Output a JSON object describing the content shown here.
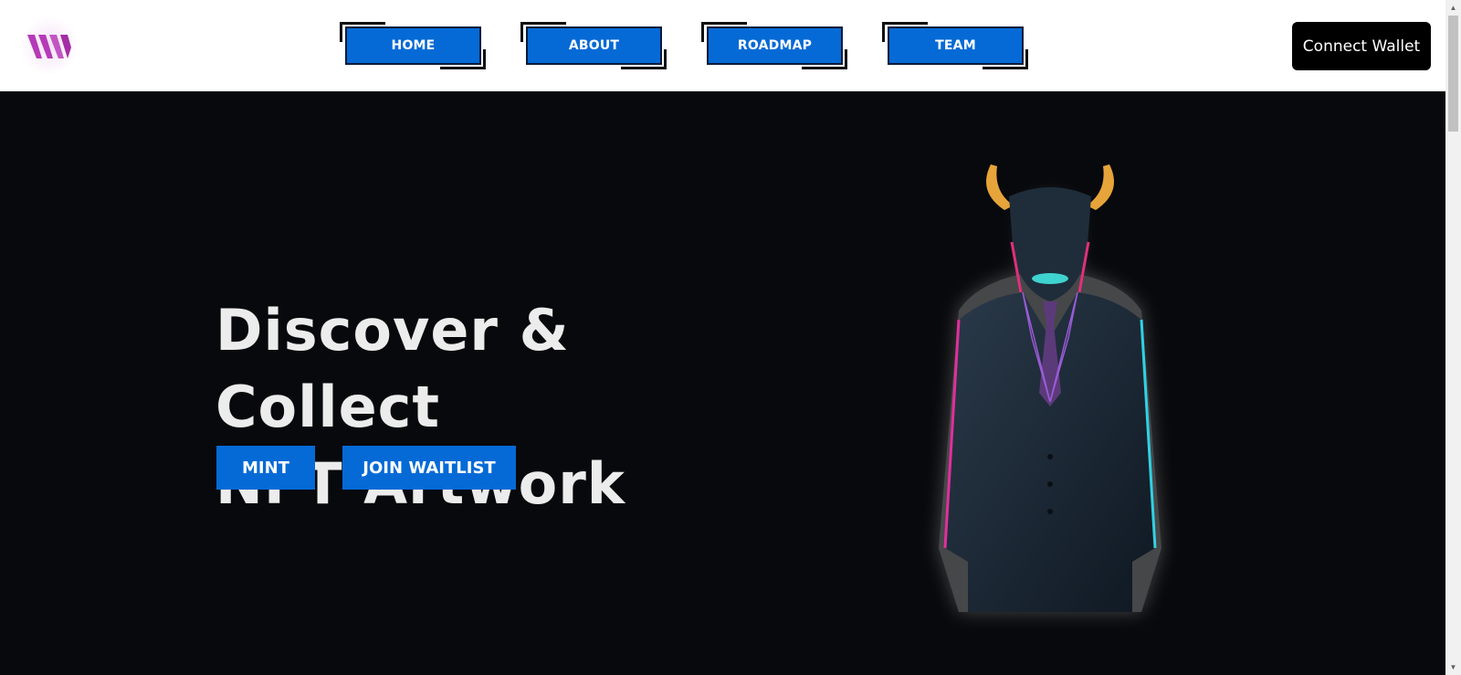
{
  "nav": {
    "items": [
      {
        "label": "HOME"
      },
      {
        "label": "ABOUT"
      },
      {
        "label": "ROADMAP"
      },
      {
        "label": "TEAM"
      }
    ],
    "connect_label": "Connect Wallet"
  },
  "hero": {
    "headline_line1": "Discover & Collect",
    "headline_line2": "NFT Artwork",
    "mint_label": "MINT",
    "waitlist_label": "JOIN WAITLIST"
  },
  "colors": {
    "accent": "#056ad6",
    "background": "#08090c",
    "logo": "#b53ab7"
  },
  "icons": {
    "logo": "w-logo-icon",
    "scroll_up": "arrow-up-icon",
    "scroll_down": "arrow-down-icon"
  }
}
